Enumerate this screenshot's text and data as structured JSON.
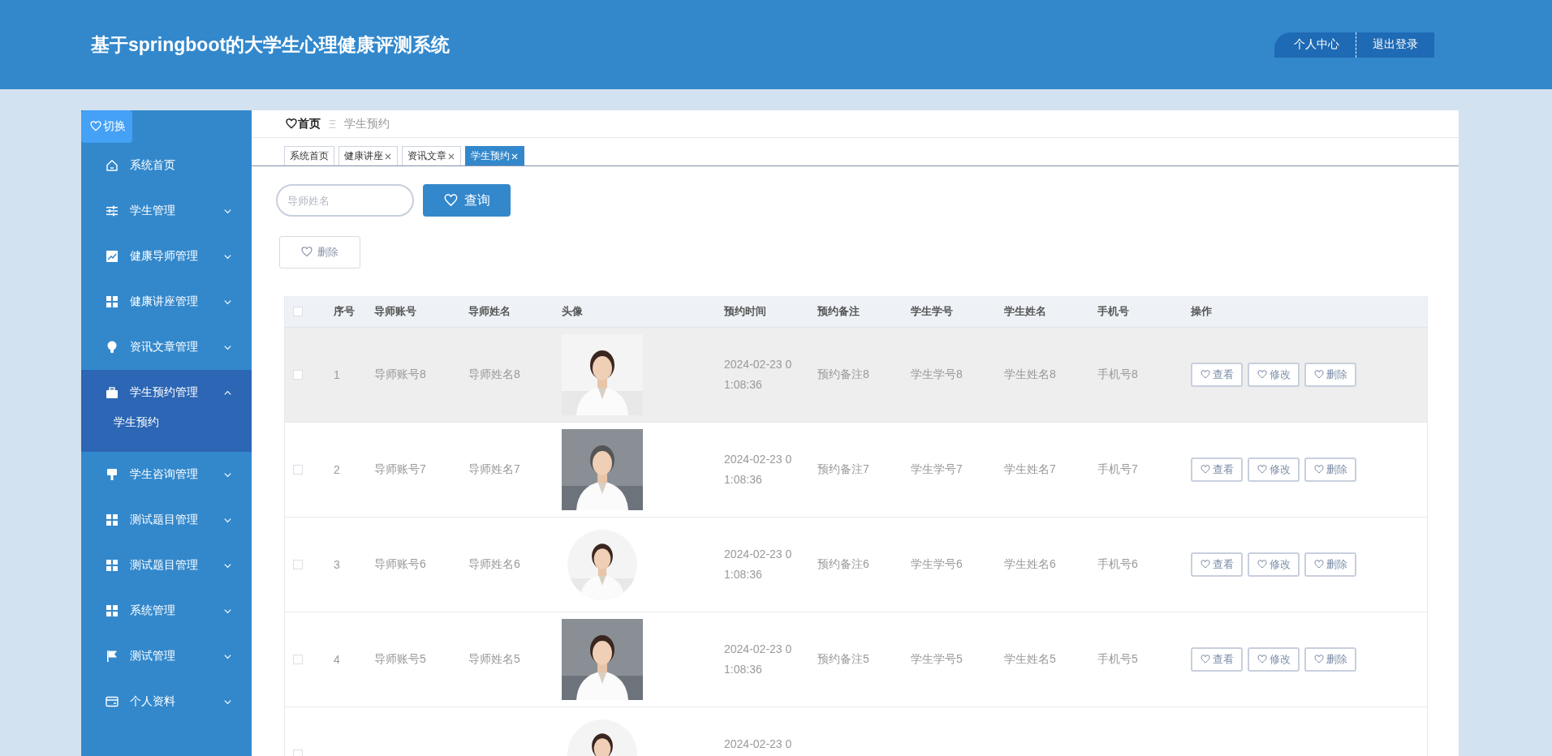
{
  "header": {
    "title": "基于springboot的大学生心理健康评测系统",
    "buttons": [
      "个人中心",
      "退出登录"
    ]
  },
  "sidebar": {
    "toggle": "切换",
    "items": [
      {
        "label": "系统首页"
      },
      {
        "label": "学生管理",
        "expanded": false
      },
      {
        "label": "健康导师管理",
        "expanded": false
      },
      {
        "label": "健康讲座管理",
        "expanded": false
      },
      {
        "label": "资讯文章管理",
        "expanded": false
      },
      {
        "label": "学生预约管理",
        "expanded": true,
        "children": [
          {
            "label": "学生预约"
          }
        ]
      },
      {
        "label": "学生咨询管理",
        "expanded": false
      },
      {
        "label": "测试题目管理",
        "expanded": false
      },
      {
        "label": "测试题目管理",
        "expanded": false
      },
      {
        "label": "系统管理",
        "expanded": false
      },
      {
        "label": "测试管理",
        "expanded": false
      },
      {
        "label": "个人资料",
        "expanded": false
      }
    ]
  },
  "breadcrumb": {
    "home": "首页",
    "separator": "Ξ",
    "current": "学生预约"
  },
  "tabs": [
    {
      "label": "系统首页",
      "closable": false,
      "selected": false
    },
    {
      "label": "健康讲座",
      "closable": true,
      "selected": false
    },
    {
      "label": "资讯文章",
      "closable": true,
      "selected": false
    },
    {
      "label": "学生预约",
      "closable": true,
      "selected": true
    }
  ],
  "search": {
    "placeholder": "导师姓名",
    "button": "查询"
  },
  "delete_button": "删除",
  "table": {
    "columns": [
      "序号",
      "导师账号",
      "导师姓名",
      "头像",
      "预约时间",
      "预约备注",
      "学生学号",
      "学生姓名",
      "手机号",
      "操作"
    ],
    "select_all_checked": false,
    "rows": [
      {
        "no": "1",
        "account": "导师账号8",
        "name": "导师姓名8",
        "round": false,
        "time": "2024-02-23 01:08:36",
        "note": "预约备注8",
        "student_no": "学生学号8",
        "student_name": "学生姓名8",
        "phone": "手机号8",
        "hovered": true,
        "checked": false,
        "actions": [
          "查看",
          "修改",
          "删除"
        ]
      },
      {
        "no": "2",
        "account": "导师账号7",
        "name": "导师姓名7",
        "round": false,
        "time": "2024-02-23 01:08:36",
        "note": "预约备注7",
        "student_no": "学生学号7",
        "student_name": "学生姓名7",
        "phone": "手机号7",
        "hovered": false,
        "checked": false,
        "actions": [
          "查看",
          "修改",
          "删除"
        ]
      },
      {
        "no": "3",
        "account": "导师账号6",
        "name": "导师姓名6",
        "round": true,
        "time": "2024-02-23 01:08:36",
        "note": "预约备注6",
        "student_no": "学生学号6",
        "student_name": "学生姓名6",
        "phone": "手机号6",
        "hovered": false,
        "checked": false,
        "actions": [
          "查看",
          "修改",
          "删除"
        ]
      },
      {
        "no": "4",
        "account": "导师账号5",
        "name": "导师姓名5",
        "round": false,
        "time": "2024-02-23 01:08:36",
        "note": "预约备注5",
        "student_no": "学生学号5",
        "student_name": "学生姓名5",
        "phone": "手机号5",
        "hovered": false,
        "checked": false,
        "actions": [
          "查看",
          "修改",
          "删除"
        ]
      },
      {
        "round": true,
        "time": "2024-02-23 0",
        "hovered": false,
        "checked": false
      }
    ]
  }
}
